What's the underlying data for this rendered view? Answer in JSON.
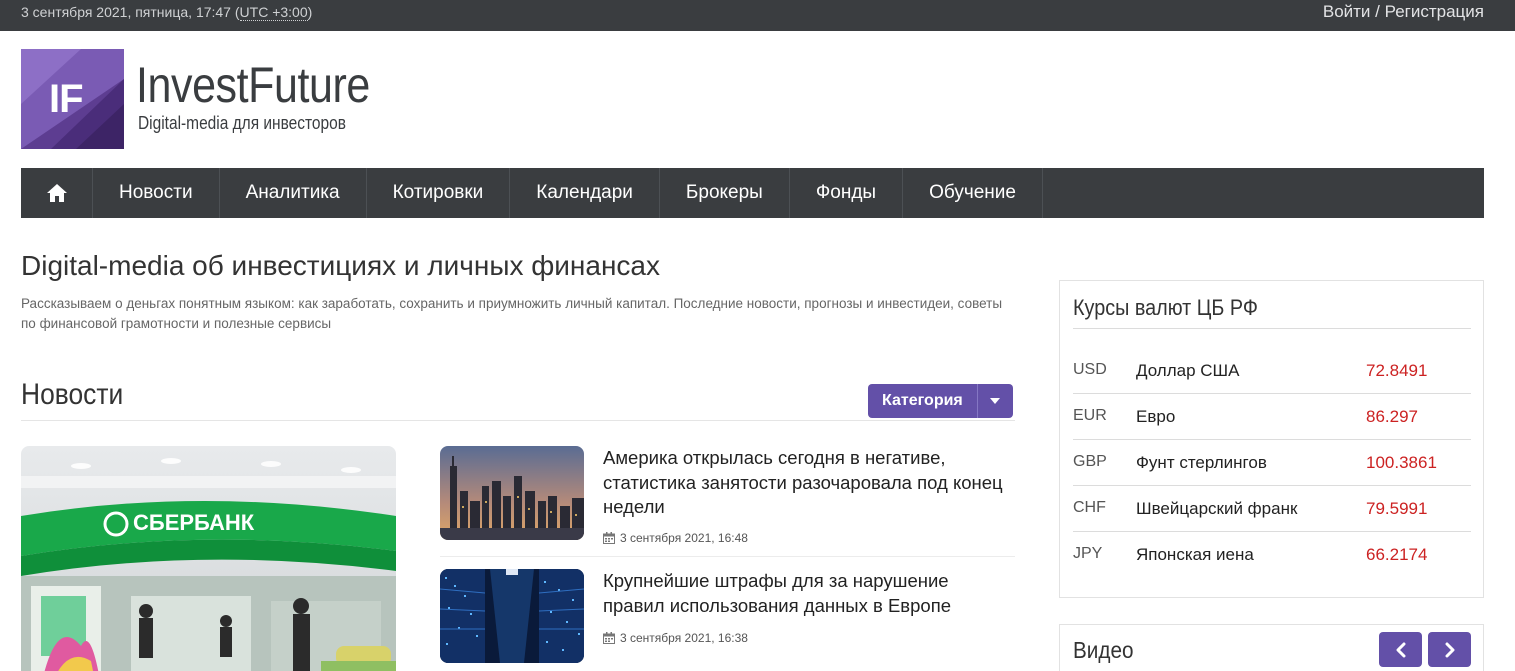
{
  "topbar": {
    "date": "3 сентября 2021, пятница, 17:47",
    "timezone": "UTC +3:00",
    "login": "Войти",
    "separator": " / ",
    "register": "Регистрация"
  },
  "brand": {
    "monogram": "IF",
    "name": "InvestFuture",
    "tagline": "Digital-media для инвесторов",
    "color": "#5d3d91"
  },
  "nav": {
    "home_icon": "home-icon",
    "items": [
      "Новости",
      "Аналитика",
      "Котировки",
      "Календари",
      "Брокеры",
      "Фонды",
      "Обучение"
    ]
  },
  "main": {
    "heading": "Digital-media об инвестициях и личных финансах",
    "lead": "Рассказываем о деньгах понятным языком: как заработать, сохранить и приумножить личный капитал. Последние новости, прогнозы и инвестидеи, советы по финансовой грамотности и полезные сервисы"
  },
  "news": {
    "title": "Новости",
    "category_button": "Категория",
    "hero_sign": "СБЕРБАНК",
    "articles": [
      {
        "title": "Америка открылась сегодня в негативе, статистика занятости разочаровала под конец недели",
        "date": "3 сентября 2021, 16:48"
      },
      {
        "title": "Крупнейшие штрафы для за нарушение правил использования данных в Европе",
        "date": "3 сентября 2021, 16:38"
      }
    ]
  },
  "currency": {
    "title": "Курсы валют ЦБ РФ",
    "rows": [
      {
        "code": "USD",
        "name": "Доллар США",
        "value": "72.8491"
      },
      {
        "code": "EUR",
        "name": "Евро",
        "value": "86.297"
      },
      {
        "code": "GBP",
        "name": "Фунт стерлингов",
        "value": "100.3861"
      },
      {
        "code": "CHF",
        "name": "Швейцарский франк",
        "value": "79.5991"
      },
      {
        "code": "JPY",
        "name": "Японская иена",
        "value": "66.2174"
      }
    ]
  },
  "video": {
    "title": "Видео"
  },
  "colors": {
    "accent": "#6350a8",
    "dark": "#3a3d40",
    "rate": "#cc2222"
  }
}
